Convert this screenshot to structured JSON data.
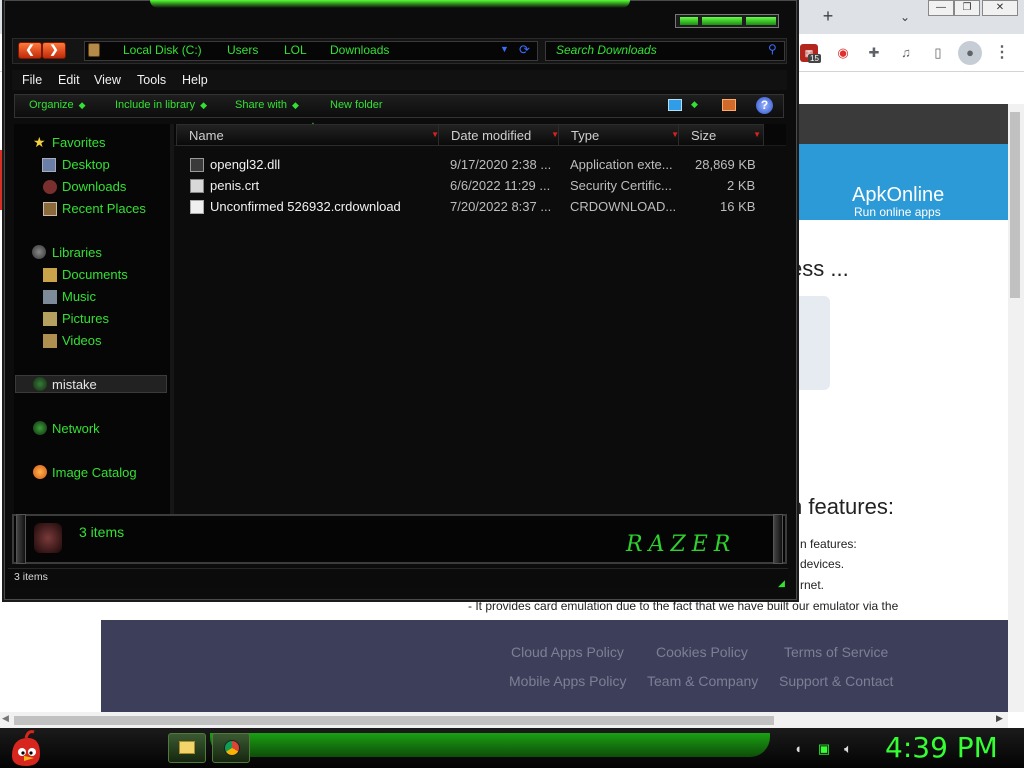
{
  "browser": {
    "page_title": "ApkOnline",
    "page_subtitle": "Run online apps",
    "heading_partial": "ess ...",
    "features_heading": "n features:",
    "body_lines": [
      "n features:",
      "devices.",
      "rnet.",
      "- It provides card emulation due to the fact that we have built our emulator via the"
    ],
    "footer_links": [
      "Cloud Apps Policy",
      "Cookies Policy",
      "Terms of Service",
      "Mobile Apps Policy",
      "Team & Company",
      "Support & Contact"
    ],
    "new_tab_symbol": "+",
    "tab_menu_symbol": "⌄",
    "minimize_symbol": "—",
    "restore_symbol": "❐",
    "close_symbol": "✕",
    "ext_badge": "15",
    "menu_symbol": "⋮"
  },
  "explorer": {
    "address": {
      "crumbs": [
        "Local Disk (C:)",
        "Users",
        "LOL",
        "Downloads"
      ],
      "search_placeholder": "Search Downloads"
    },
    "menu": [
      "File",
      "Edit",
      "View",
      "Tools",
      "Help"
    ],
    "commands": [
      "Organize",
      "Include in library",
      "Share with",
      "New folder"
    ],
    "help_symbol": "?",
    "nav": {
      "favorites_label": "Favorites",
      "favorites": [
        "Desktop",
        "Downloads",
        "Recent Places"
      ],
      "libraries_label": "Libraries",
      "libraries": [
        "Documents",
        "Music",
        "Pictures",
        "Videos"
      ],
      "selected_item": "mistake",
      "network": "Network",
      "image_catalog": "Image Catalog"
    },
    "columns": [
      "Name",
      "Date modified",
      "Type",
      "Size"
    ],
    "files": [
      {
        "name": "opengl32.dll",
        "date": "9/17/2020 2:38 ...",
        "type": "Application exte...",
        "size": "28,869 KB",
        "icon": "dll-icon"
      },
      {
        "name": "penis.crt",
        "date": "6/6/2022 11:29 ...",
        "type": "Security Certific...",
        "size": "2 KB",
        "icon": "certificate-icon"
      },
      {
        "name": "Unconfirmed 526932.crdownload",
        "date": "7/20/2022 8:37 ...",
        "type": "CRDOWNLOAD...",
        "size": "16 KB",
        "icon": "file-icon"
      }
    ],
    "details_count": "3 items",
    "brand_text": "RAZER",
    "status_text": "3 items"
  },
  "taskbar": {
    "clock": "4:39 PM"
  },
  "colors": {
    "accent_green": "#34e034",
    "explorer_bg": "#0c0c0c",
    "apk_blue": "#2d9ad8",
    "footer_bg": "#3d3e5a"
  }
}
